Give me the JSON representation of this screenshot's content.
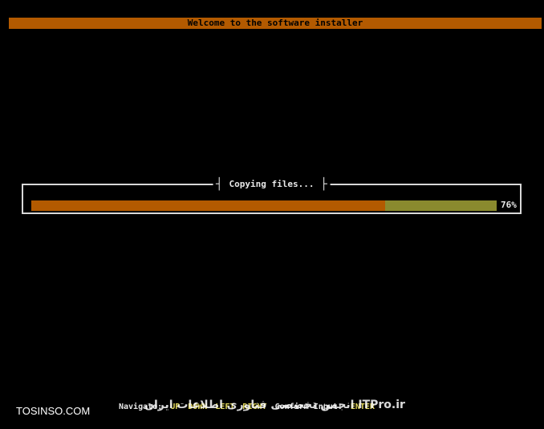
{
  "header": {
    "title": "Welcome to the software installer"
  },
  "dialog": {
    "title": "Copying files...",
    "progress_percent": 76,
    "progress_label": "76%"
  },
  "status_bar": {
    "navigate_label": "Navigate:",
    "keys": [
      "UP",
      "DOWN",
      "LEFT",
      "RIGHT"
    ],
    "confirm_label": "Confirm Input:",
    "confirm_key": "ENTER"
  },
  "watermarks": {
    "left": "TOSINSO.COM",
    "overlay": "انجمن تخصصی فناوری اطلاعات ایران ITPro.ir"
  },
  "colors": {
    "background": "#000000",
    "accent": "#b35a00",
    "progress_track": "#8a8a2e",
    "key_highlight": "#e3d85a",
    "text": "#e8e8e8"
  }
}
